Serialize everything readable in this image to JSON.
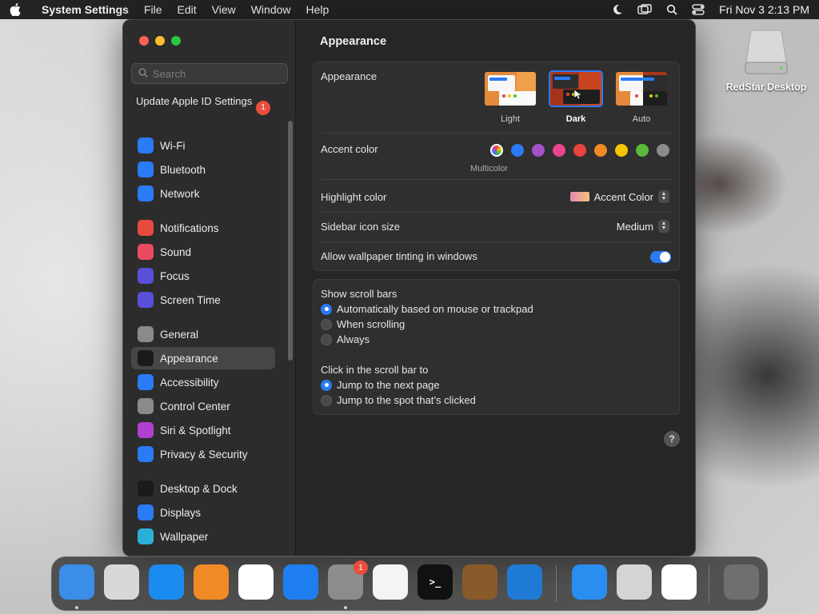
{
  "menubar": {
    "app_name": "System Settings",
    "items": [
      "File",
      "Edit",
      "View",
      "Window",
      "Help"
    ],
    "clock": "Fri Nov 3  2:13 PM"
  },
  "desktop": {
    "drive_label": "RedStar Desktop"
  },
  "sidebar": {
    "search_placeholder": "Search",
    "apple_id": {
      "label": "Update Apple ID Settings",
      "badge": "1"
    },
    "items": [
      {
        "label": "Wi-Fi",
        "icon": "wifi-icon",
        "color": "#2a7bf6"
      },
      {
        "label": "Bluetooth",
        "icon": "bluetooth-icon",
        "color": "#2a7bf6"
      },
      {
        "label": "Network",
        "icon": "globe-icon",
        "color": "#2a7bf6"
      },
      {
        "label": "Notifications",
        "icon": "bell-icon",
        "color": "#e94a3f"
      },
      {
        "label": "Sound",
        "icon": "speaker-icon",
        "color": "#e94a5f"
      },
      {
        "label": "Focus",
        "icon": "moon-icon",
        "color": "#5a4fd8"
      },
      {
        "label": "Screen Time",
        "icon": "hourglass-icon",
        "color": "#5a4fd8"
      },
      {
        "label": "General",
        "icon": "gear-icon",
        "color": "#8a8a8a"
      },
      {
        "label": "Appearance",
        "icon": "appearance-icon",
        "color": "#1a1a1a",
        "selected": true
      },
      {
        "label": "Accessibility",
        "icon": "accessibility-icon",
        "color": "#2a7bf6"
      },
      {
        "label": "Control Center",
        "icon": "control-center-icon",
        "color": "#8a8a8a"
      },
      {
        "label": "Siri & Spotlight",
        "icon": "siri-icon",
        "color": "#b040d0"
      },
      {
        "label": "Privacy & Security",
        "icon": "hand-icon",
        "color": "#2a7bf6"
      },
      {
        "label": "Desktop & Dock",
        "icon": "dock-icon",
        "color": "#1a1a1a"
      },
      {
        "label": "Displays",
        "icon": "sun-icon",
        "color": "#2a7bf6"
      },
      {
        "label": "Wallpaper",
        "icon": "flower-icon",
        "color": "#2ab0d8"
      }
    ]
  },
  "main": {
    "title": "Appearance",
    "appearance": {
      "label": "Appearance",
      "options": [
        {
          "label": "Light",
          "selected": false
        },
        {
          "label": "Dark",
          "selected": true
        },
        {
          "label": "Auto",
          "selected": false
        }
      ]
    },
    "accent": {
      "label": "Accent color",
      "selected_label": "Multicolor",
      "colors": [
        "#2a7bf6",
        "#a450c8",
        "#e8478b",
        "#e9433f",
        "#f08a24",
        "#f5c500",
        "#5cb83a",
        "#8c8c8c"
      ]
    },
    "highlight": {
      "label": "Highlight color",
      "value": "Accent Color"
    },
    "icon_size": {
      "label": "Sidebar icon size",
      "value": "Medium"
    },
    "tinting": {
      "label": "Allow wallpaper tinting in windows",
      "enabled": true
    },
    "scroll_bars": {
      "label": "Show scroll bars",
      "options": [
        {
          "label": "Automatically based on mouse or trackpad",
          "selected": true
        },
        {
          "label": "When scrolling",
          "selected": false
        },
        {
          "label": "Always",
          "selected": false
        }
      ]
    },
    "click_scroll": {
      "label": "Click in the scroll bar to",
      "options": [
        {
          "label": "Jump to the next page",
          "selected": true
        },
        {
          "label": "Jump to the spot that’s clicked",
          "selected": false
        }
      ]
    },
    "help": "?"
  },
  "dock": {
    "apps": [
      {
        "name": "finder-icon"
      },
      {
        "name": "launchpad-icon"
      },
      {
        "name": "safari-icon"
      },
      {
        "name": "firefox-icon"
      },
      {
        "name": "chrome-icon"
      },
      {
        "name": "app-store-icon"
      },
      {
        "name": "system-settings-icon",
        "badge": "1"
      },
      {
        "name": "textedit-icon"
      },
      {
        "name": "terminal-icon",
        "glyph": ">_"
      },
      {
        "name": "garageband-icon"
      },
      {
        "name": "vscode-icon"
      },
      {
        "name": "keynote-icon"
      },
      {
        "name": "preview-icon"
      },
      {
        "name": "photos-icon"
      },
      {
        "name": "trash-icon"
      }
    ]
  }
}
